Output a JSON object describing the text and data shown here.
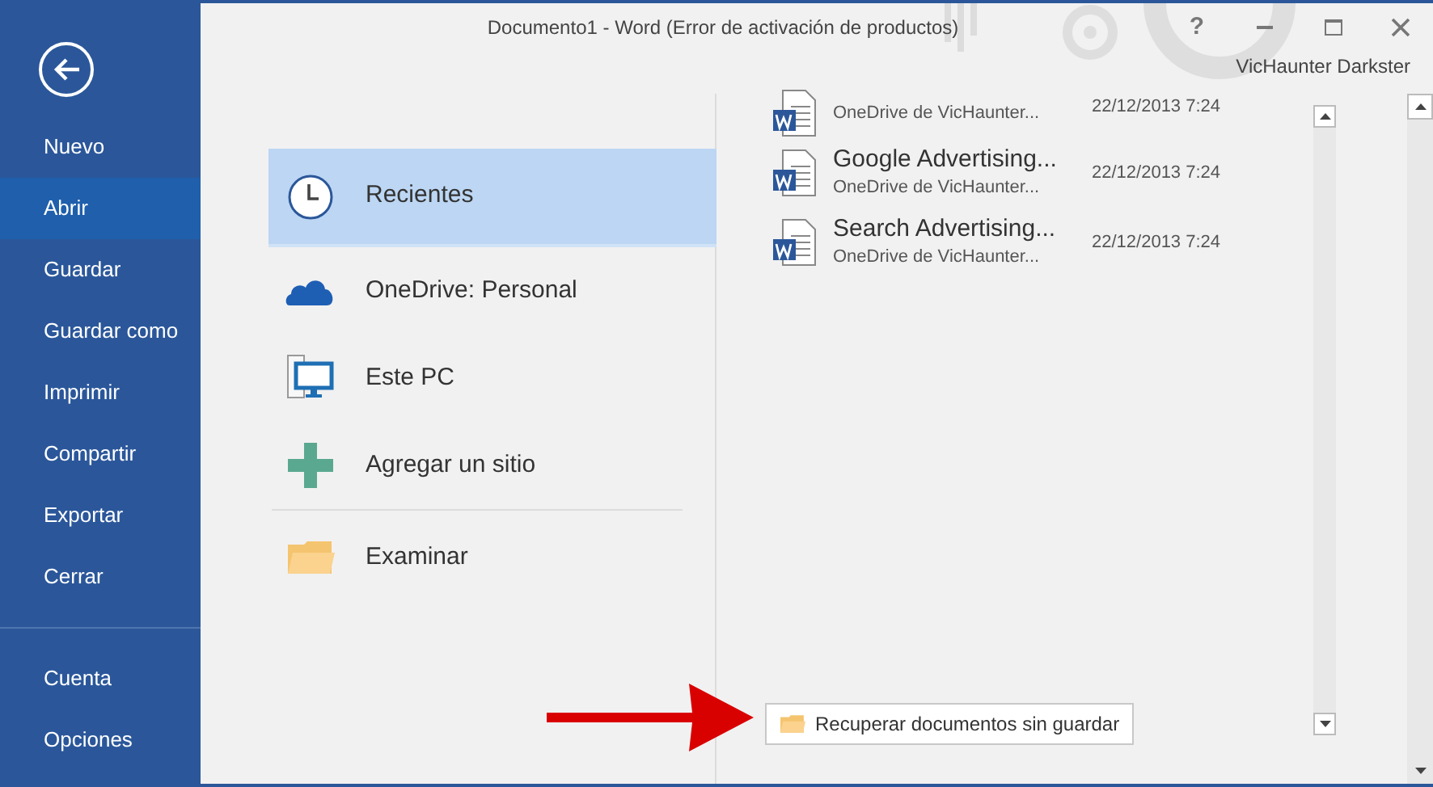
{
  "window": {
    "title": "Documento1 - Word (Error de activación de productos)",
    "controls": [
      {
        "kind": "help",
        "label": "?"
      },
      {
        "kind": "minimize"
      },
      {
        "kind": "maximize"
      },
      {
        "kind": "close"
      }
    ],
    "user": "VicHaunter Darkster"
  },
  "sidebar": {
    "items": [
      {
        "label": "Nuevo",
        "selected": false
      },
      {
        "label": "Abrir",
        "selected": true
      },
      {
        "label": "Guardar",
        "selected": false
      },
      {
        "label": "Guardar como",
        "selected": false
      },
      {
        "label": "Imprimir",
        "selected": false
      },
      {
        "label": "Compartir",
        "selected": false
      },
      {
        "label": "Exportar",
        "selected": false
      },
      {
        "label": "Cerrar",
        "selected": false
      }
    ],
    "bottom_items": [
      {
        "label": "Cuenta",
        "selected": false
      },
      {
        "label": "Opciones",
        "selected": false
      }
    ]
  },
  "places": [
    {
      "kind": "recent",
      "label": "Recientes",
      "selected": true
    },
    {
      "kind": "onedrive",
      "label": "OneDrive: Personal",
      "selected": false
    },
    {
      "kind": "pc",
      "label": "Este PC",
      "selected": false
    },
    {
      "kind": "add",
      "label": "Agregar un sitio",
      "selected": false
    },
    {
      "kind": "browse",
      "label": "Examinar",
      "selected": false
    }
  ],
  "recent_files": [
    {
      "location": "OneDrive de VicHaunter...",
      "date": "22/12/2013 7:24"
    },
    {
      "name": "Google Advertising...",
      "location": "OneDrive de VicHaunter...",
      "date": "22/12/2013 7:24"
    },
    {
      "name": "Search Advertising...",
      "location": "OneDrive de VicHaunter...",
      "date": "22/12/2013 7:24"
    }
  ],
  "recover_button": "Recuperar documentos sin guardar"
}
